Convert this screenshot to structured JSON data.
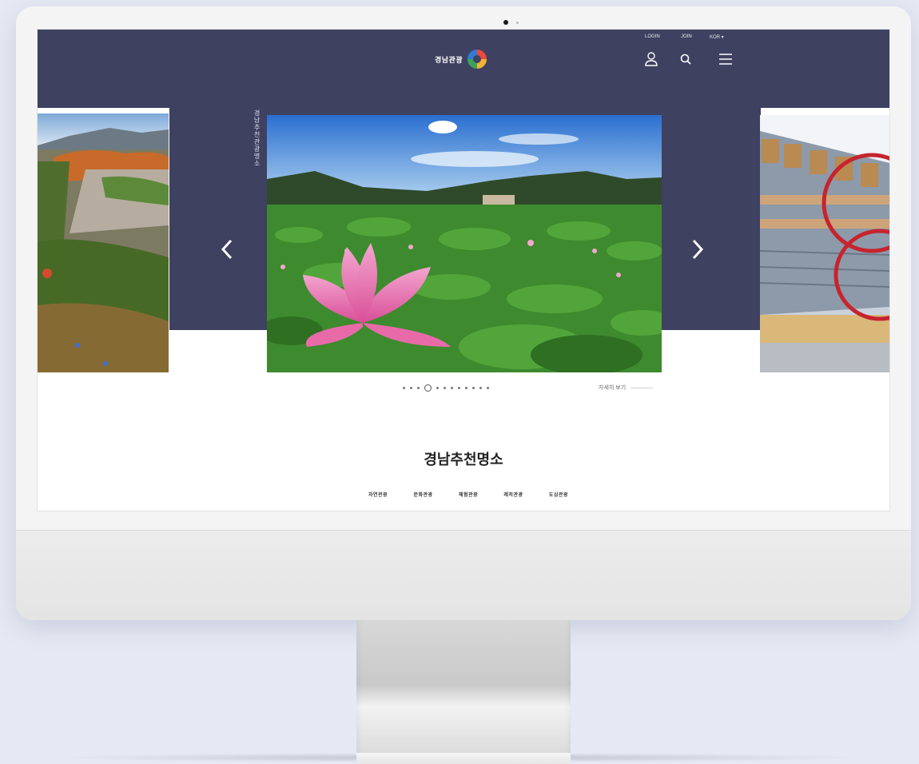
{
  "header": {
    "logo_text": "경남관광",
    "util_links": [
      "LOGIN",
      "JOIN",
      "KOR ▾"
    ],
    "icons": {
      "user": "user-icon",
      "search": "search-icon",
      "menu": "hamburger-menu-icon"
    }
  },
  "hero": {
    "vertical_label": "경남추천관광명소",
    "view_all": "자세히 보기",
    "dots_total": 12,
    "active_dot": 4
  },
  "section": {
    "title": "경남추천명소",
    "categories": [
      "자연관광",
      "문화관광",
      "체험관광",
      "레저관광",
      "도심관광"
    ]
  },
  "colors": {
    "header_bg": "#3e4160",
    "page_bg": "#e6e9f3"
  }
}
